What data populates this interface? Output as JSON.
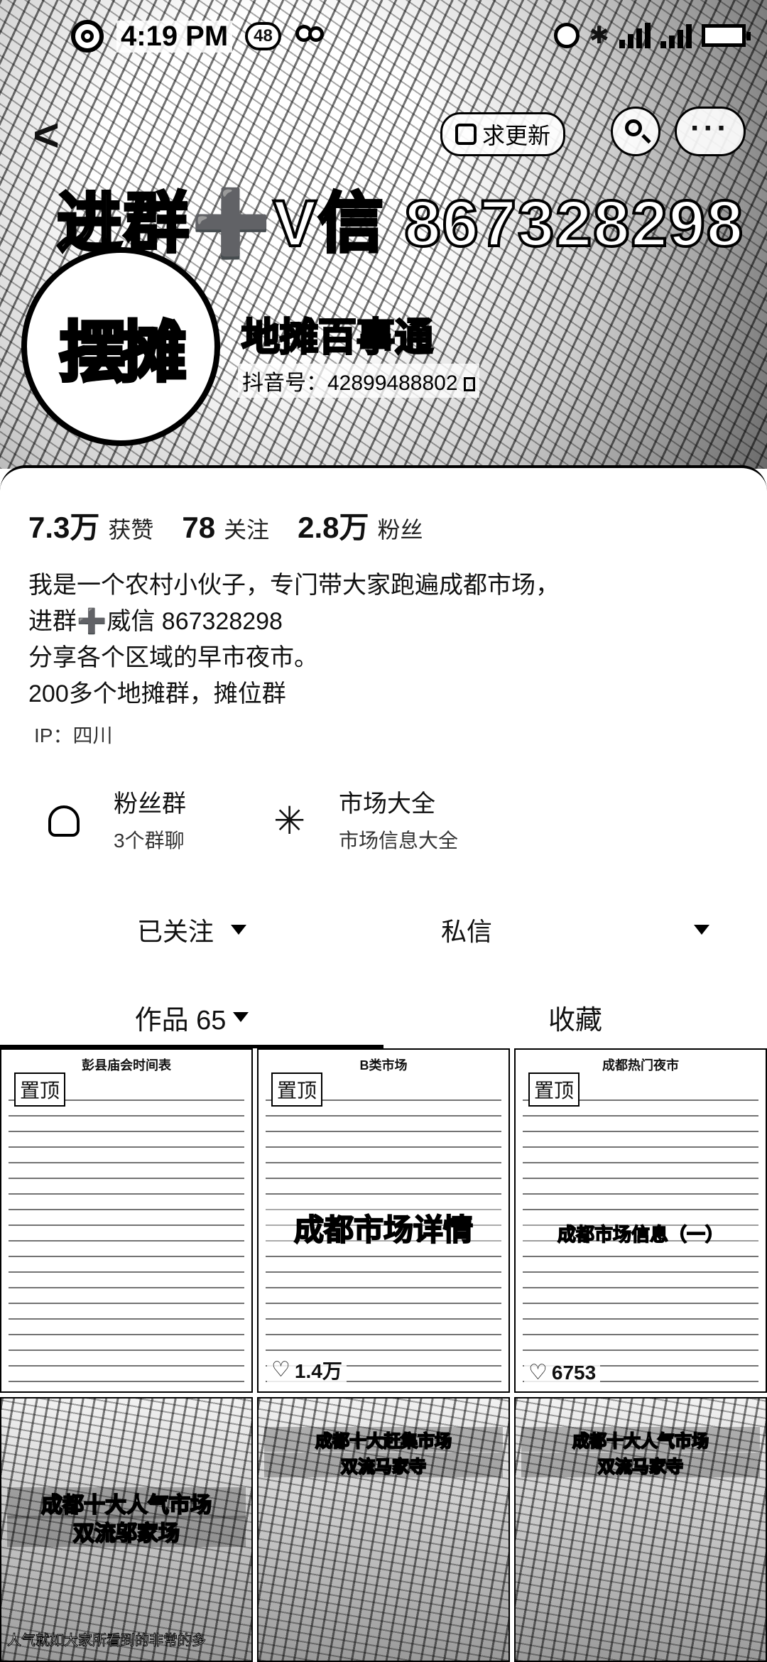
{
  "status_bar": {
    "time": "4:19 PM",
    "notification_count": "48"
  },
  "nav": {
    "update_label": "求更新"
  },
  "cover": {
    "title": "进群➕V信 867328298",
    "avatar_logo": "摆摊"
  },
  "profile": {
    "nickname": "地摊百事通",
    "douyin_id": "抖音号：42899488802",
    "stats": [
      {
        "value": "7.3万",
        "label": "获赞"
      },
      {
        "value": "78",
        "label": "关注"
      },
      {
        "value": "2.8万",
        "label": "粉丝"
      }
    ],
    "bio": [
      "我是一个农村小伙子，专门带大家跑遍成都市场，",
      "进群➕威信 867328298",
      "分享各个区域的早市夜市。",
      "200多个地摊群，摊位群"
    ],
    "ip": "IP：四川"
  },
  "entries": [
    {
      "title": "粉丝群",
      "subtitle": "3个群聊",
      "icon": "fans-group-icon"
    },
    {
      "title": "市场大全",
      "subtitle": "市场信息大全",
      "icon": "asterisk-icon"
    }
  ],
  "actions": {
    "followed_label": "已关注",
    "message_label": "私信"
  },
  "tabs": {
    "works_label": "作品 65",
    "favorites_label": "收藏"
  },
  "grid": {
    "tiles": [
      {
        "pinned": "置顶",
        "header": "彭县庙会时间表",
        "overlay": "",
        "likes": ""
      },
      {
        "pinned": "置顶",
        "header": "B类市场",
        "overlay": "成都市场详情",
        "likes": "1.4万"
      },
      {
        "pinned": "置顶",
        "header": "成都热门夜市",
        "overlay": "成都市场信息（一）",
        "likes": "6753"
      },
      {
        "title_line1": "成都十大人气市场",
        "title_line2": "双流邬家场",
        "caption": "人气就如大家所看到的非常的多"
      },
      {
        "title_line1": "成都十大赶集市场",
        "title_line2": "双流马家寺",
        "caption": ""
      },
      {
        "title_line1": "成都十大人气市场",
        "title_line2": "双流马家寺",
        "caption": ""
      }
    ]
  },
  "colors": {
    "background": "#ffffff",
    "text": "#111111"
  }
}
